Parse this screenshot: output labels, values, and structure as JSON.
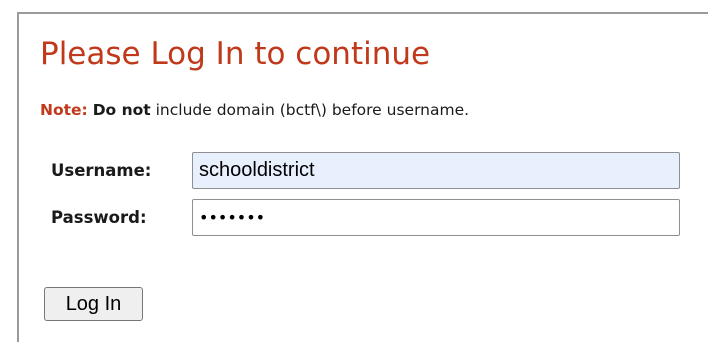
{
  "login": {
    "title": "Please Log In to continue",
    "note": {
      "label": "Note:",
      "emphasis": "Do not",
      "text": " include domain (bctf\\) before username."
    },
    "username": {
      "label": "Username:",
      "value": "schooldistrict"
    },
    "password": {
      "label": "Password:",
      "value": "•••••••"
    },
    "submit_label": "Log In"
  },
  "colors": {
    "accent": "#c0391b",
    "autofill_background": "#e8f0fe",
    "panel_border": "#9a9a9a"
  }
}
